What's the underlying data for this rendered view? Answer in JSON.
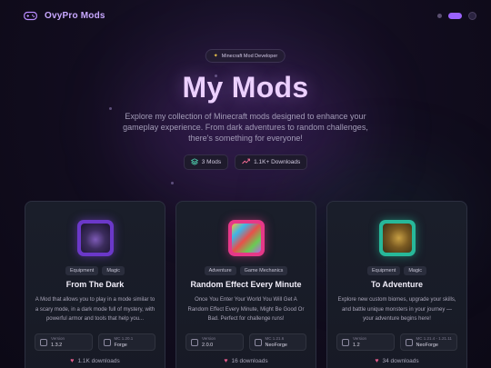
{
  "brand": {
    "name": "OvyPro Mods",
    "icon": "gamepad-icon"
  },
  "hero": {
    "badge": "Minecraft Mod Developer",
    "title": "My Mods",
    "description": "Explore my collection of Minecraft mods designed to enhance your gameplay experience. From dark adventures to random challenges, there's something for everyone!",
    "stats": [
      {
        "icon": "layers-icon",
        "label": "3 Mods"
      },
      {
        "icon": "trending-up-icon",
        "label": "1.1K+ Downloads"
      }
    ]
  },
  "cards": [
    {
      "title": "From The Dark",
      "tags": [
        "Equipment",
        "Magic"
      ],
      "description": "A Mod that allows you to play in a mode similar to a scary mode, in a dark mode full of mystery, with powerful armor and tools that help you...",
      "version_label": "Version",
      "version": "1.3.2",
      "mc_label": "MC 1.20.1",
      "loader": "Forge",
      "downloads": "1.1K downloads"
    },
    {
      "title": "Random Effect Every Minute",
      "tags": [
        "Adventure",
        "Game Mechanics"
      ],
      "description": "Once You Enter Your World You Will Get A Random Effect Every Minute, Might Be Good Or Bad. Perfect for challenge runs!",
      "version_label": "Version",
      "version": "2.0.0",
      "mc_label": "MC 1.21.6",
      "loader": "NeoForge",
      "downloads": "16 downloads"
    },
    {
      "title": "To Adventure",
      "tags": [
        "Equipment",
        "Magic"
      ],
      "description": "Explore new custom biomes, upgrade your skills, and battle unique monsters in your journey — your adventure begins here!",
      "version_label": "Version",
      "version": "1.2",
      "mc_label": "MC 1.21.4 - 1.21.11",
      "loader": "NeoForge",
      "downloads": "34 downloads"
    }
  ],
  "colors": {
    "accent": "#9b63ff",
    "title": "#ecd0ff",
    "card1_frame": "#6b38c9",
    "card2_frame": "#e63888",
    "card3_frame": "#27b89a"
  }
}
